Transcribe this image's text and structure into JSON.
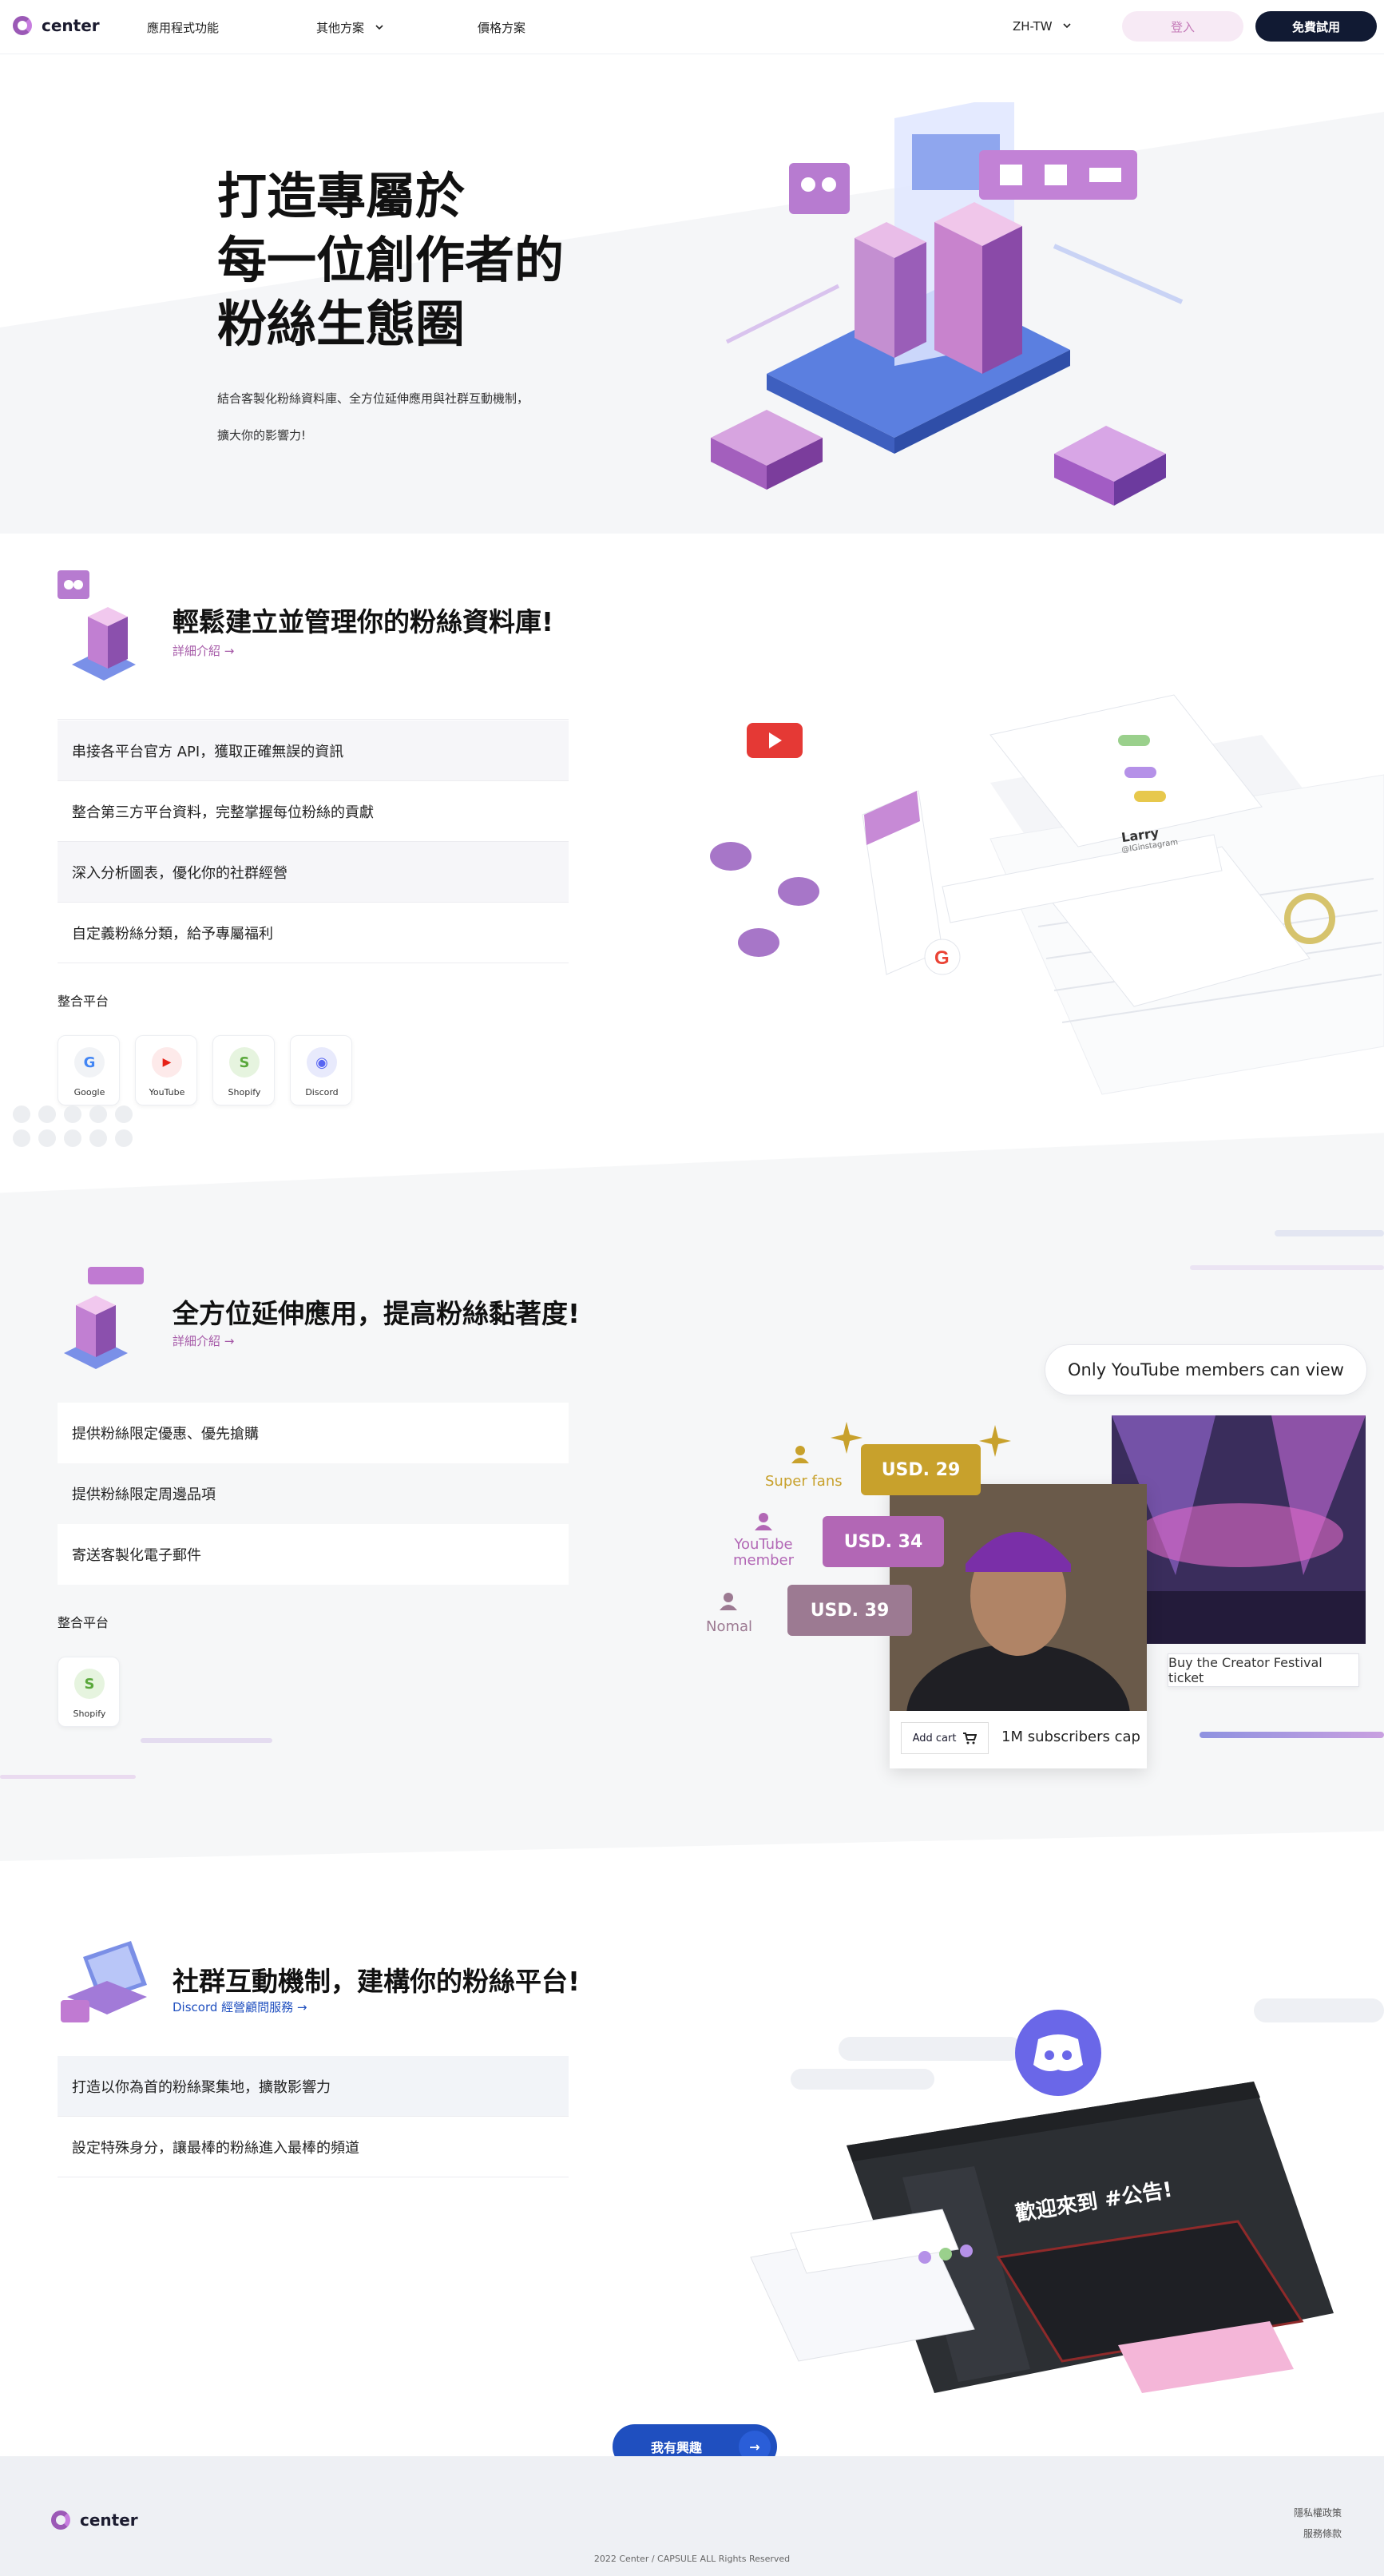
{
  "brand": {
    "name": "center",
    "accent": "#9b59b6",
    "dark": "#111a33"
  },
  "nav": {
    "links": [
      "應用程式功能",
      "其他方案",
      "價格方案"
    ],
    "lang": "ZH-TW",
    "login": "登入",
    "signup": "免費試用"
  },
  "hero": {
    "title_lines": [
      "打造專屬於",
      "每一位創作者的",
      "粉絲生態圈"
    ],
    "desc1": "結合客製化粉絲資料庫、全方位延伸應用與社群互動機制，",
    "desc2": "擴大你的影響力!"
  },
  "section1": {
    "title": "輕鬆建立並管理你的粉絲資料庫!",
    "link": "詳細介紹 →",
    "features": [
      "串接各平台官方 API，獲取正確無誤的資訊",
      "整合第三方平台資料，完整掌握每位粉絲的貢獻",
      "深入分析圖表，優化你的社群經營",
      "自定義粉絲分類，給予專屬福利"
    ],
    "platforms_label": "整合平台",
    "platforms": [
      {
        "name": "Google",
        "icon": "google-icon",
        "glyph": "G",
        "color": "#4285f4",
        "bg": "#f1f3f6"
      },
      {
        "name": "YouTube",
        "icon": "youtube-icon",
        "glyph": "▶",
        "color": "#ffffff",
        "bg": "#e62117"
      },
      {
        "name": "Shopify",
        "icon": "shopify-icon",
        "glyph": "S",
        "color": "#ffffff",
        "bg": "#5cb85c"
      },
      {
        "name": "Discord",
        "icon": "discord-icon",
        "glyph": "◉",
        "color": "#5865f2",
        "bg": "#e8eafc"
      }
    ],
    "mock": {
      "profile_name": "Larry",
      "handle": "@IGinstagram"
    }
  },
  "section2": {
    "title": "全方位延伸應用，提高粉絲黏著度!",
    "link": "詳細介紹 →",
    "features": [
      "提供粉絲限定優惠、優先搶購",
      "提供粉絲限定周邊品項",
      "寄送客製化電子郵件"
    ],
    "platforms_label": "整合平台",
    "platforms": [
      {
        "name": "Shopify",
        "icon": "shopify-icon",
        "glyph": "S",
        "color": "#ffffff",
        "bg": "#5cb85c"
      }
    ],
    "members_only": "Only YouTube members can view",
    "tiers": [
      {
        "label": "Super fans",
        "price": "USD. 29",
        "color": "#c8a12c"
      },
      {
        "label": "YouTube member",
        "price": "USD. 34",
        "color": "#b267b5"
      },
      {
        "label": "Nomal",
        "price": "USD. 39",
        "color": "#9c7a92"
      }
    ],
    "add_cart": "Add cart",
    "product": "1M subscribers cap",
    "festival": "Buy the Creator Festival ticket"
  },
  "section3": {
    "title": "社群互動機制，建構你的粉絲平台!",
    "link": "Discord 經營顧問服務  →",
    "features": [
      "打造以你為首的粉絲聚集地，擴散影響力",
      "設定特殊身分，讓最棒的粉絲進入最棒的頻道"
    ],
    "discord_heading": "歡迎來到 #公告!"
  },
  "cta": {
    "label": "我有興趣",
    "arrow": "→"
  },
  "footer": {
    "brand": "center",
    "links": [
      "隱私權政策",
      "服務條款"
    ],
    "copyright": "2022 Center / CAPSULE ALL Rights Reserved"
  }
}
